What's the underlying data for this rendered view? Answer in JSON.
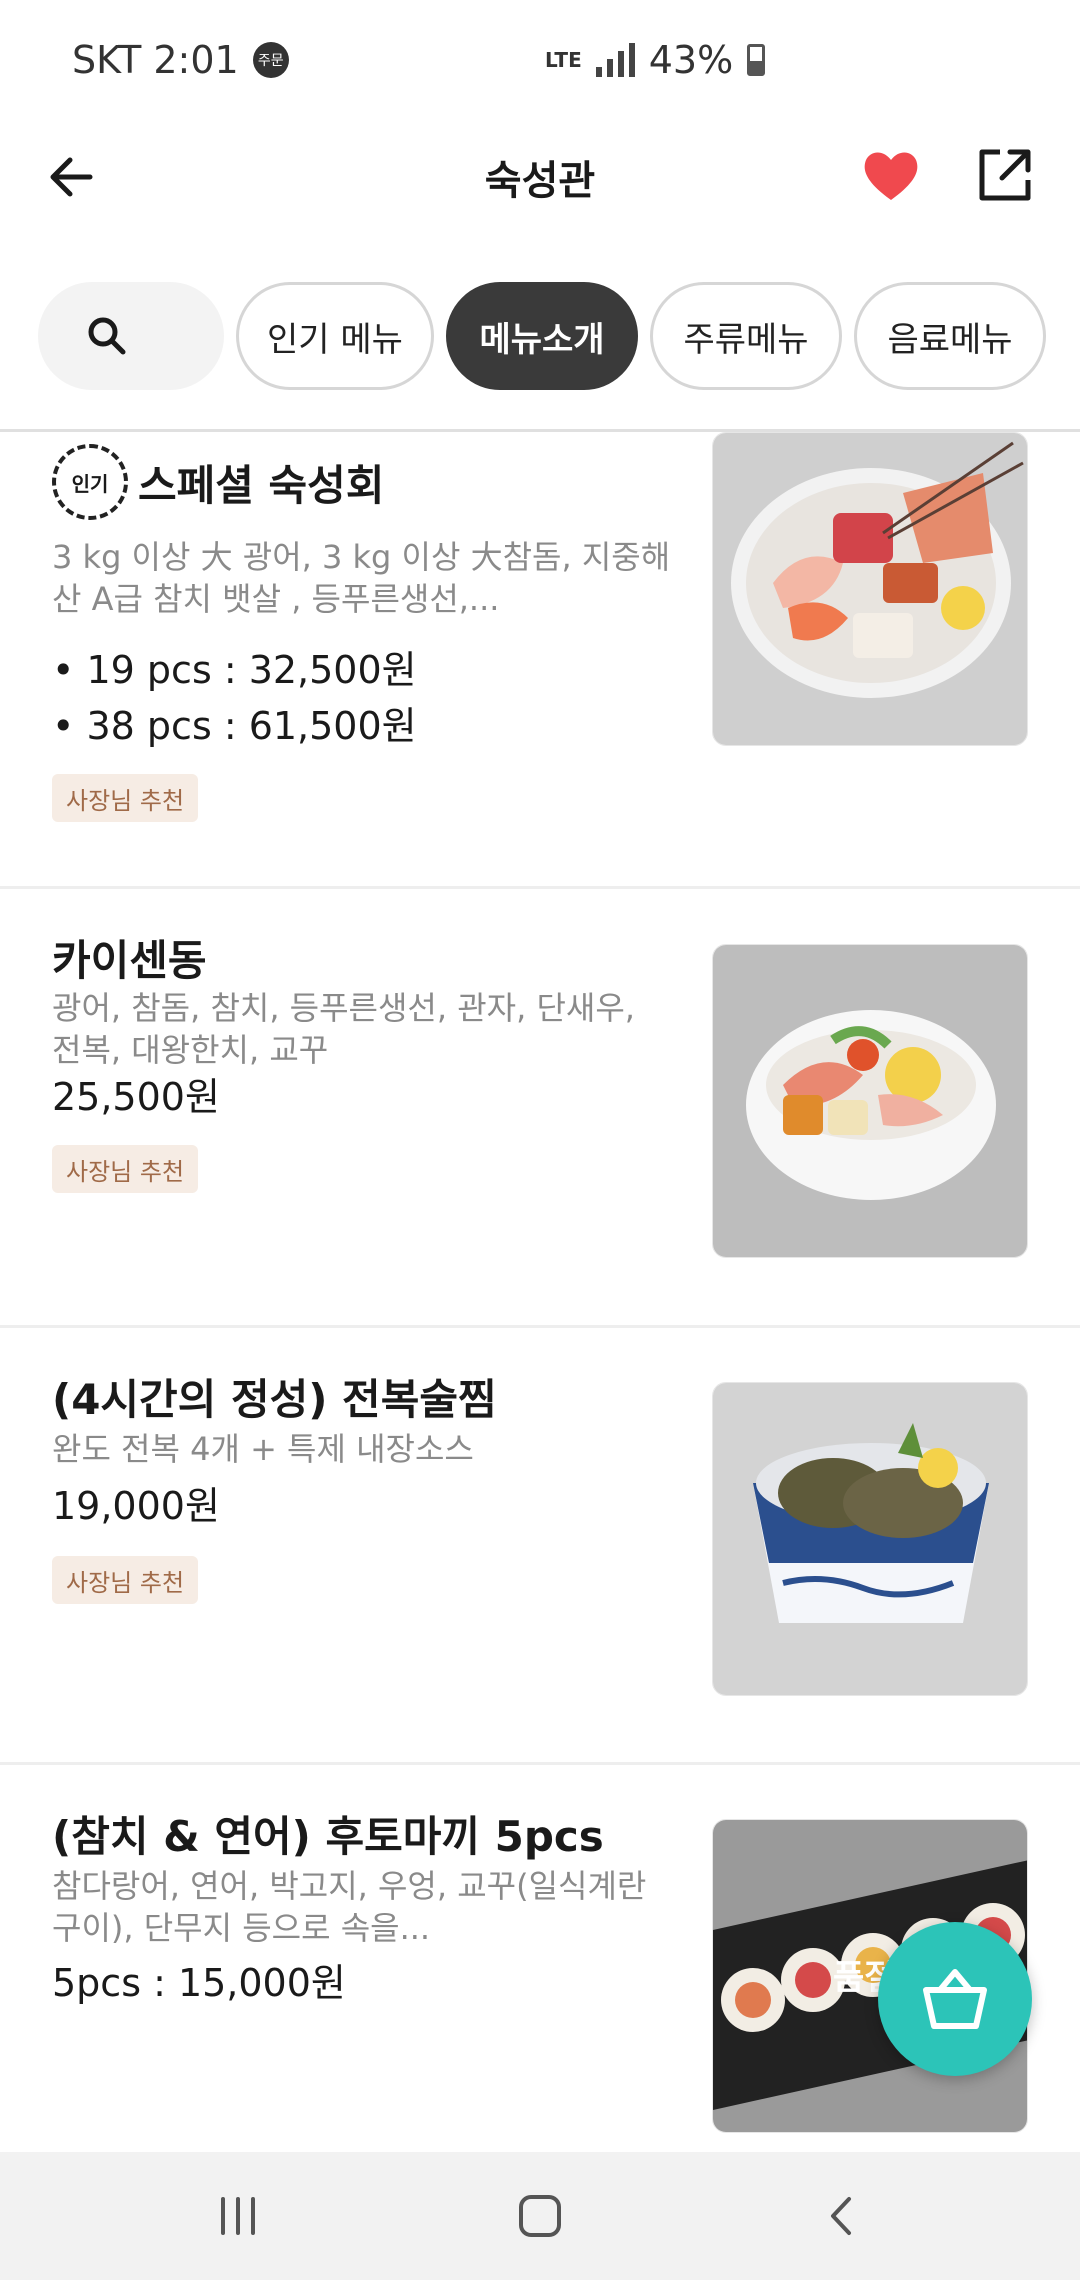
{
  "status_bar": {
    "carrier_time": "SKT 2:01",
    "badge": "주문",
    "network": "LTE",
    "battery": "43%"
  },
  "header": {
    "title": "숙성관",
    "favorite_color": "#f0494e"
  },
  "tabs": [
    {
      "label": "인기 메뉴",
      "active": false
    },
    {
      "label": "메뉴소개",
      "active": true
    },
    {
      "label": "주류메뉴",
      "active": false
    },
    {
      "label": "음료메뉴",
      "active": false
    }
  ],
  "items": [
    {
      "popular_label": "인기",
      "name": "스페셜 숙성회",
      "description": "3 kg 이상 大 광어, 3 kg 이상 大참돔, 지중해산 A급 참치 뱃살 , 등푸른생선,...",
      "prices": [
        "• 19 pcs : 32,500원",
        "• 38 pcs : 61,500원"
      ],
      "badge": "사장님 추천"
    },
    {
      "name": "카이센동",
      "description": "광어, 참돔, 참치, 등푸른생선, 관자, 단새우, 전복, 대왕한치, 교꾸",
      "prices": [
        "25,500원"
      ],
      "badge": "사장님 추천"
    },
    {
      "name": "(4시간의 정성) 전복술찜",
      "description": "완도 전복 4개 + 특제 내장소스",
      "prices": [
        "19,000원"
      ],
      "badge": "사장님 추천"
    },
    {
      "name": "(참치 & 연어) 후토마끼 5pcs",
      "description": "참다랑어, 연어, 박고지, 우엉, 교꾸(일식계란구이), 단무지 등으로 속을...",
      "prices": [
        "5pcs : 15,000원"
      ],
      "image_overlay": "품절"
    }
  ],
  "accent_color": "#2cc4b8"
}
